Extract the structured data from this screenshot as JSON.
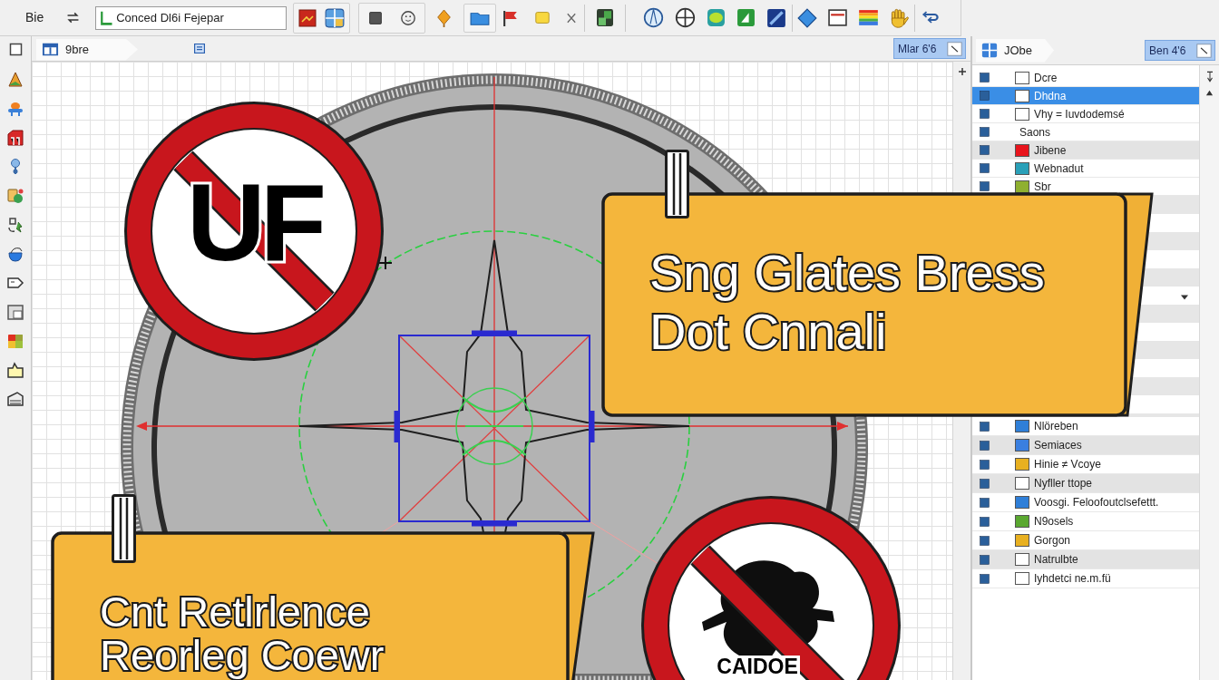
{
  "toolbar": {
    "menu_label": "Bie",
    "path_field": {
      "value": "Conced Dl6i Fejepar"
    }
  },
  "document_tab": {
    "label": "9bre",
    "selected": true
  },
  "canvas_button": {
    "label": "Mlar 6'6"
  },
  "canvas": {
    "notes": [
      {
        "lines": [
          "Sng Glates Bress",
          "Dot Cnnali"
        ]
      },
      {
        "lines": [
          "Cnt Retlrlence",
          "Reorleg Coewr"
        ]
      }
    ],
    "signs": [
      {
        "kind": "letters",
        "text": "UF"
      },
      {
        "kind": "silhouette",
        "caption": "CAIDOE"
      }
    ]
  },
  "panel": {
    "tab": {
      "label": "JObe",
      "selected": true
    },
    "button": {
      "label": "Ben 4'6"
    },
    "rows_top": [
      {
        "label": "Dcre",
        "kind": "box",
        "selected": false,
        "shaded": false
      },
      {
        "label": "Dhdna",
        "kind": "box",
        "selected": true,
        "shaded": false
      },
      {
        "label": "Vhy = Iuvdodemsé",
        "kind": "box",
        "selected": false,
        "shaded": false
      },
      {
        "label": "Saons",
        "kind": "none",
        "selected": false,
        "shaded": false
      },
      {
        "label": "Jibene",
        "kind": "swatch",
        "color": "#e8141c",
        "selected": false,
        "shaded": true
      },
      {
        "label": "Webnadut",
        "kind": "swatch",
        "color": "#2aa0b8",
        "selected": false,
        "shaded": false
      },
      {
        "label": "Sbr",
        "kind": "swatch",
        "color": "#8fb030",
        "selected": false,
        "shaded": false
      }
    ],
    "rows_bottom": [
      {
        "label": "Nlöreben",
        "kind": "swatch",
        "color": "#2f7fd8",
        "selected": false,
        "shaded": false
      },
      {
        "label": "Semiaces",
        "kind": "swatch",
        "color": "#3a7fe0",
        "selected": false,
        "shaded": true
      },
      {
        "label": "Hinie ≠ Vcoye",
        "kind": "swatch",
        "color": "#e8b020",
        "selected": false,
        "shaded": false
      },
      {
        "label": "Nyfller ttope",
        "kind": "box",
        "selected": false,
        "shaded": true
      },
      {
        "label": "Voosgi. Feloofoutclsefettt.",
        "kind": "swatch",
        "color": "#2f7fd8",
        "selected": false,
        "shaded": false
      },
      {
        "label": "N9osels",
        "kind": "swatch",
        "color": "#5aa830",
        "selected": false,
        "shaded": false
      },
      {
        "label": "Gorgon",
        "kind": "swatch",
        "color": "#e8b020",
        "selected": false,
        "shaded": false
      },
      {
        "label": "Natrulbte",
        "kind": "box",
        "selected": false,
        "shaded": true
      },
      {
        "label": "Iyhdetci ne.m.fü",
        "kind": "box",
        "selected": false,
        "shaded": false
      }
    ]
  }
}
